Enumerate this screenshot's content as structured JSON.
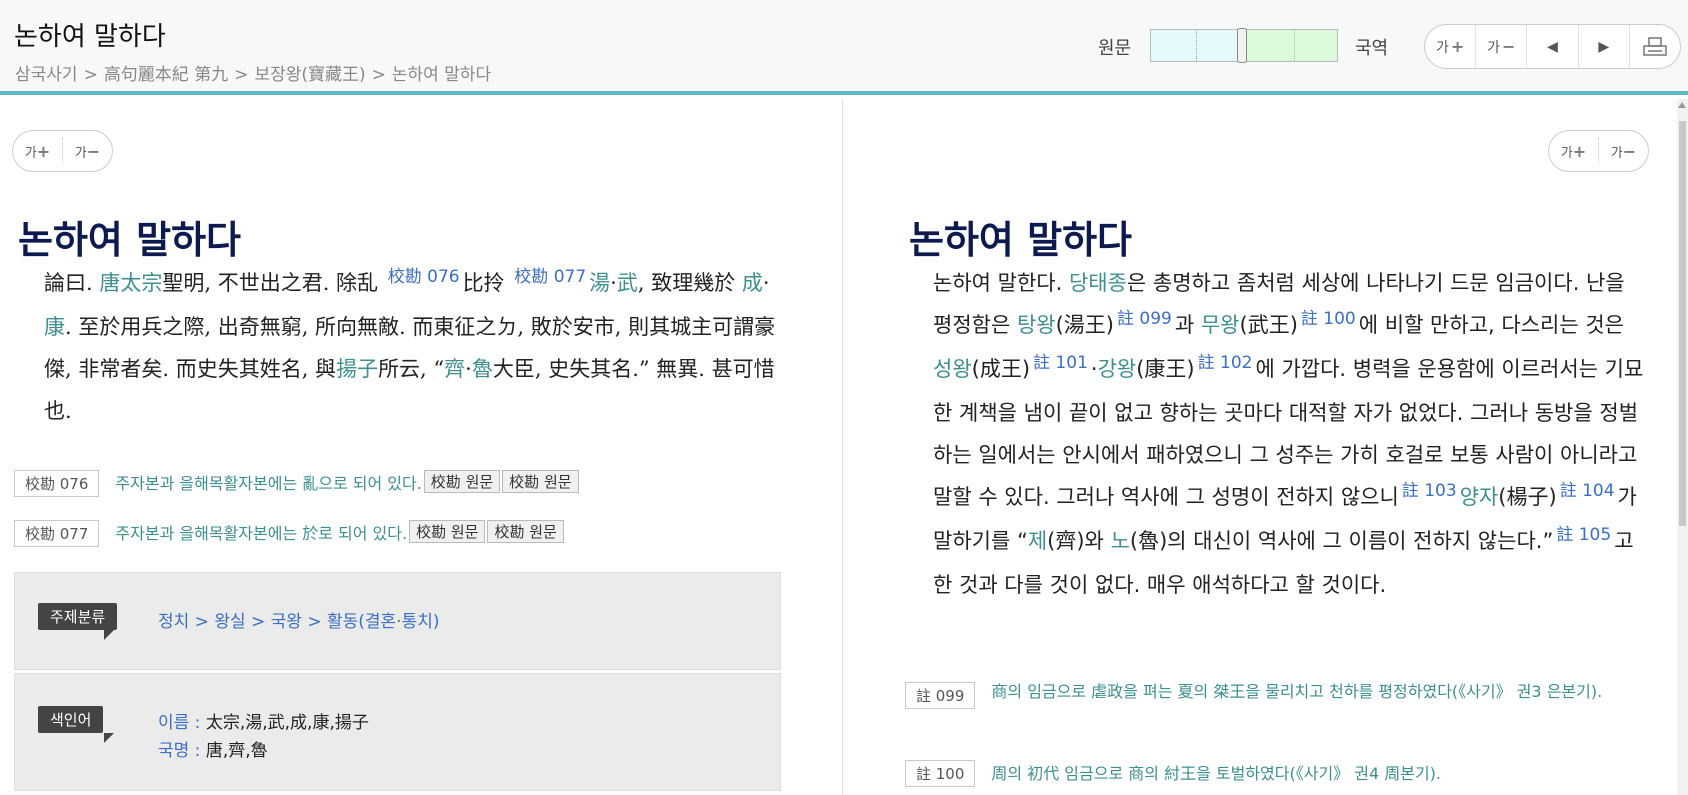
{
  "header": {
    "title": "논하여 말하다",
    "breadcrumb": [
      "삼국사기",
      "高句麗本紀 第九",
      "보장왕(寶藏王)",
      "논하여 말하다"
    ],
    "ratio_left_label": "원문",
    "ratio_right_label": "국역",
    "toolbar": {
      "font_up": "가",
      "font_down": "가",
      "prev": "◀",
      "next": "▶",
      "print": "🖶"
    }
  },
  "left": {
    "font_up": "가",
    "font_down": "가",
    "title": "논하여 말하다",
    "text": {
      "t1": "論曰. ",
      "l1": "唐太宗",
      "t2": "聖明, 不世出之君. 除乱 ",
      "r1": "校勘 076",
      "t3": "比",
      "t3b": "拎 ",
      "r2": "校勘 077",
      "l2": "湯",
      "t4": "·",
      "l3": "武",
      "t5": ", 致理幾於 ",
      "l4": "成",
      "t6": "·",
      "l5": "康",
      "t7": ". 至於用兵之際, 出奇無窮, 所向無敵. 而東征之",
      "t7b": "ㄉ",
      "t7c": ", 敗於安市, 則其城主可謂豪傑, 非常者矣. 而史失其姓名, 與",
      "l6": "揚子",
      "t8": "所云, “",
      "l7": "齊",
      "t9": "·",
      "l8": "魯",
      "t10": "大臣, 史失其名.” 無異. 甚可惜也."
    },
    "notes": [
      {
        "tag": "校勘 076",
        "text": "주자본과 을해목활자본에는 亂으로 되어 있다.",
        "btn1": "校勘 원문",
        "btn2": "校勘 원문"
      },
      {
        "tag": "校勘 077",
        "text": "주자본과 을해목활자본에는 於로 되어 있다.",
        "btn1": "校勘 원문",
        "btn2": "校勘 원문"
      }
    ],
    "subject": {
      "badge": "주제분류",
      "path": "정치 > 왕실 > 국왕 > 활동(결혼·통치)"
    },
    "index": {
      "badge": "색인어",
      "name_label": "이름 : ",
      "name_value": "太宗,湯,武,成,康,揚子",
      "country_label": "국명 : ",
      "country_value": "唐,齊,魯"
    }
  },
  "right": {
    "font_up": "가",
    "font_down": "가",
    "title": "논하여 말하다",
    "text": {
      "t1": "논하여 말한다. ",
      "l1": "당태종",
      "t2": "은 총명하고 좀처럼 세상에 나타나기 드문 임금이다. 난을 평정함은 ",
      "l2": "탕왕",
      "t3": "(湯王)",
      "r1": "註 099",
      "t4": "과 ",
      "l3": "무왕",
      "t5": "(武王)",
      "r2": "註 100",
      "t6": "에 비할 만하고, 다스리는 것은 ",
      "l4": "성왕",
      "t7": "(成王)",
      "r3": "註 101",
      "t8": "·",
      "l5": "강왕",
      "t9": "(康王)",
      "r4": "註 102",
      "t10": "에 가깝다. 병력을 운용함에 이르러서는 기묘한 계책을 냄이 끝이 없고 향하는 곳마다 대적할 자가 없었다. 그러나 동방을 정벌하는 일에서는 안시에서 패하였으니 그 성주는 가히 호걸로 보통 사람이 아니라고 말할 수 있다. 그러나 역사에 그 성명이 전하지 않으니",
      "r5": "註 103",
      "l6": "양자",
      "t11": "(楊子)",
      "r6": "註 104",
      "t12": "가 말하기를 “",
      "l7": "제",
      "t13": "(齊)와 ",
      "l8": "노",
      "t14": "(魯)의 대신이 역사에 그 이름이 전하지 않는다.”",
      "r7": "註 105",
      "t15": "고 한 것과 다를 것이 없다. 매우 애석하다고 할 것이다."
    },
    "notes": [
      {
        "tag": "註 099",
        "text": "商의 임금으로 虐政을 펴는 夏의 桀王을 물리치고 천하를 평정하였다(《사기》 권3 은본기)."
      },
      {
        "tag": "註 100",
        "text": "周의 初代 임금으로 商의 紂王을 토벌하였다(《사기》 권4 周본기)."
      }
    ]
  }
}
